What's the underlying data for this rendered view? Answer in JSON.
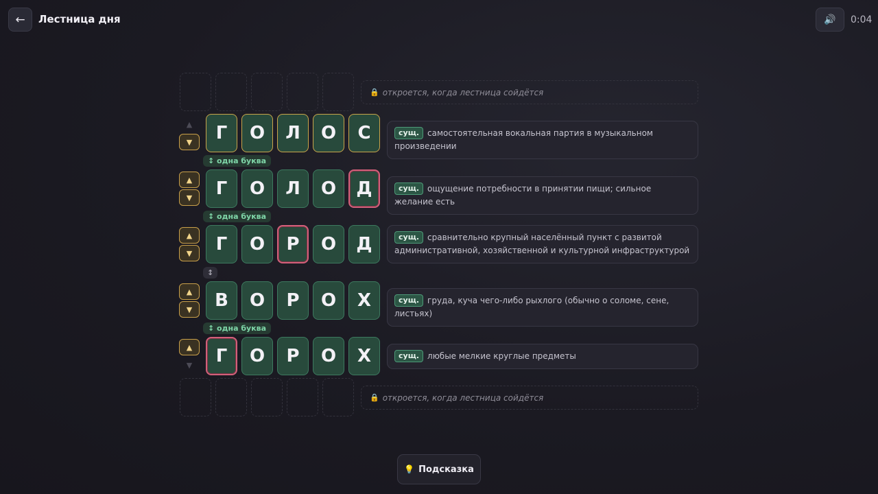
{
  "header": {
    "back_label": "←",
    "title": "Лестница дня",
    "sound_icon": "🔊",
    "timer": "0:04"
  },
  "locked_text": "откроется, когда лестница сойдётся",
  "lock_icon": "🔒",
  "up_arrow": "▲",
  "down_arrow": "▼",
  "rows": [
    {
      "word": "голос",
      "letters": [
        "Г",
        "О",
        "Л",
        "О",
        "С"
      ],
      "pos": "сущ.",
      "definition": "самостоятельная вокальная партия в музыкальном произведении"
    },
    {
      "word": "голод",
      "letters": [
        "Г",
        "О",
        "Л",
        "О",
        "Д"
      ],
      "pos": "сущ.",
      "definition": "ощущение потребности в принятии пищи; сильное желание есть"
    },
    {
      "word": "город",
      "letters": [
        "Г",
        "О",
        "Р",
        "О",
        "Д"
      ],
      "pos": "сущ.",
      "definition": "сравнительно крупный населённый пункт с развитой административной, хозяйственной и культурной инфраструктурой"
    },
    {
      "word": "ворох",
      "letters": [
        "В",
        "О",
        "Р",
        "О",
        "Х"
      ],
      "pos": "сущ.",
      "definition": "груда, куча чего-либо рыхлого (обычно о соломе, сене, листьях)"
    },
    {
      "word": "горох",
      "letters": [
        "Г",
        "О",
        "Р",
        "О",
        "Х"
      ],
      "pos": "сущ.",
      "definition": "любые мелкие круглые предметы"
    }
  ],
  "links": [
    {
      "label": "↕ одна буква"
    },
    {
      "label": "↕ одна буква"
    },
    {
      "label": "↕"
    },
    {
      "label": "↕ одна буква"
    }
  ],
  "hint_icon": "💡",
  "hint_label": "Подсказка",
  "colors": {
    "tile_bg": "#284a3c",
    "tile_border": "#3d7a5f",
    "gold_border": "#c9a54a",
    "changed_border": "#d2607a",
    "badge_text": "#7fd6a8"
  }
}
